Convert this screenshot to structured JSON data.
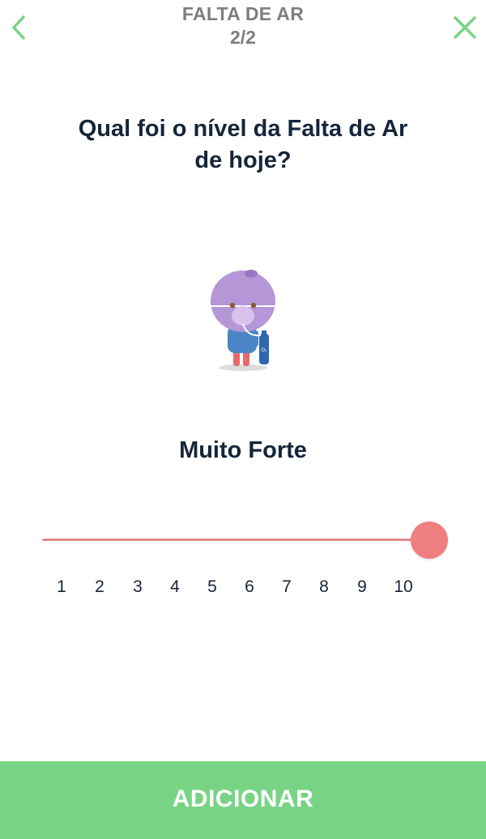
{
  "header": {
    "title": "FALTA DE AR",
    "step": "2/2",
    "back_icon": "chevron-left-icon",
    "close_icon": "close-icon"
  },
  "question": {
    "line1": "Qual foi o nível da Falta de Ar",
    "line2": "de hoje?"
  },
  "illustration": {
    "icon": "patient-with-oxygen-tank-icon",
    "tank_label": "O₂"
  },
  "level": {
    "label": "Muito Forte",
    "value": 10,
    "min": 1,
    "max": 10
  },
  "scale": {
    "ticks": [
      "1",
      "2",
      "3",
      "4",
      "5",
      "6",
      "7",
      "8",
      "9",
      "10"
    ]
  },
  "footer": {
    "add_label": "ADICIONAR"
  },
  "colors": {
    "accent_green": "#78d484",
    "slider_red": "#ee7e7f",
    "text_dark": "#15253a",
    "header_gray": "#7b7f82"
  }
}
